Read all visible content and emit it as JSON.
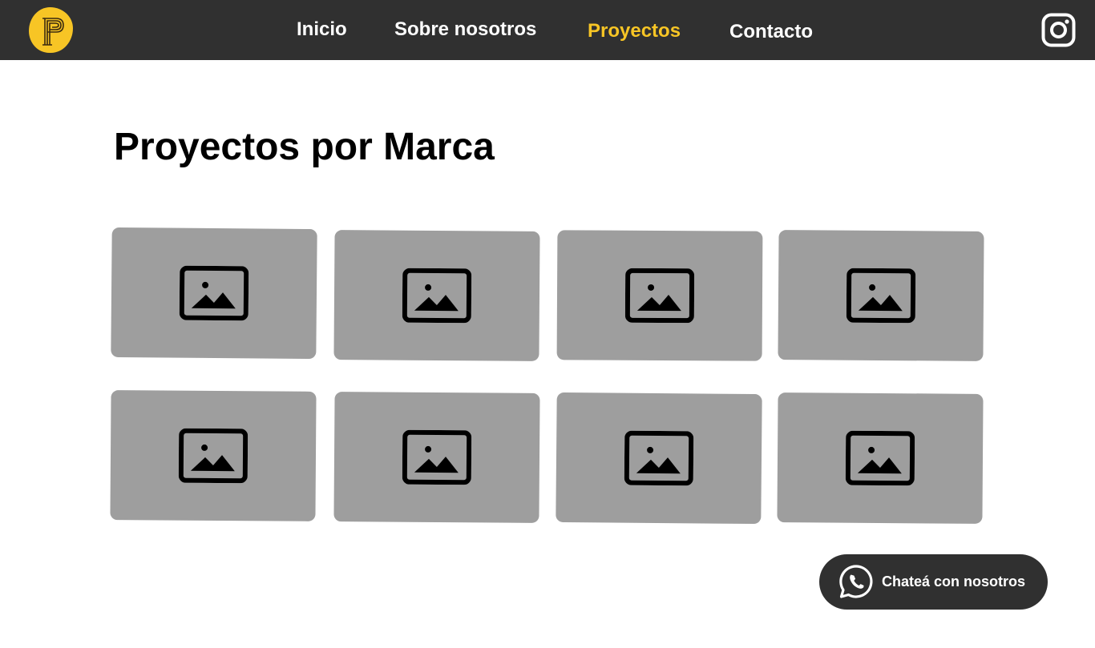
{
  "header": {
    "logo_icon": "p-letter-logo-icon",
    "nav": [
      {
        "label": "Inicio",
        "active": false
      },
      {
        "label": "Sobre nosotros",
        "active": false
      },
      {
        "label": "Proyectos",
        "active": true
      },
      {
        "label": "Contacto",
        "active": false
      }
    ],
    "social_icon": "instagram-icon"
  },
  "main": {
    "title": "Proyectos por Marca",
    "cards": [
      {
        "icon": "image-placeholder-icon"
      },
      {
        "icon": "image-placeholder-icon"
      },
      {
        "icon": "image-placeholder-icon"
      },
      {
        "icon": "image-placeholder-icon"
      },
      {
        "icon": "image-placeholder-icon"
      },
      {
        "icon": "image-placeholder-icon"
      },
      {
        "icon": "image-placeholder-icon"
      },
      {
        "icon": "image-placeholder-icon"
      }
    ]
  },
  "chat_button": {
    "label": "Chateá con nosotros",
    "icon": "whatsapp-icon"
  },
  "colors": {
    "header_bg": "#303030",
    "accent": "#f7c525",
    "card_bg": "#9e9e9e",
    "text_light": "#ffffff",
    "text_dark": "#000000"
  }
}
